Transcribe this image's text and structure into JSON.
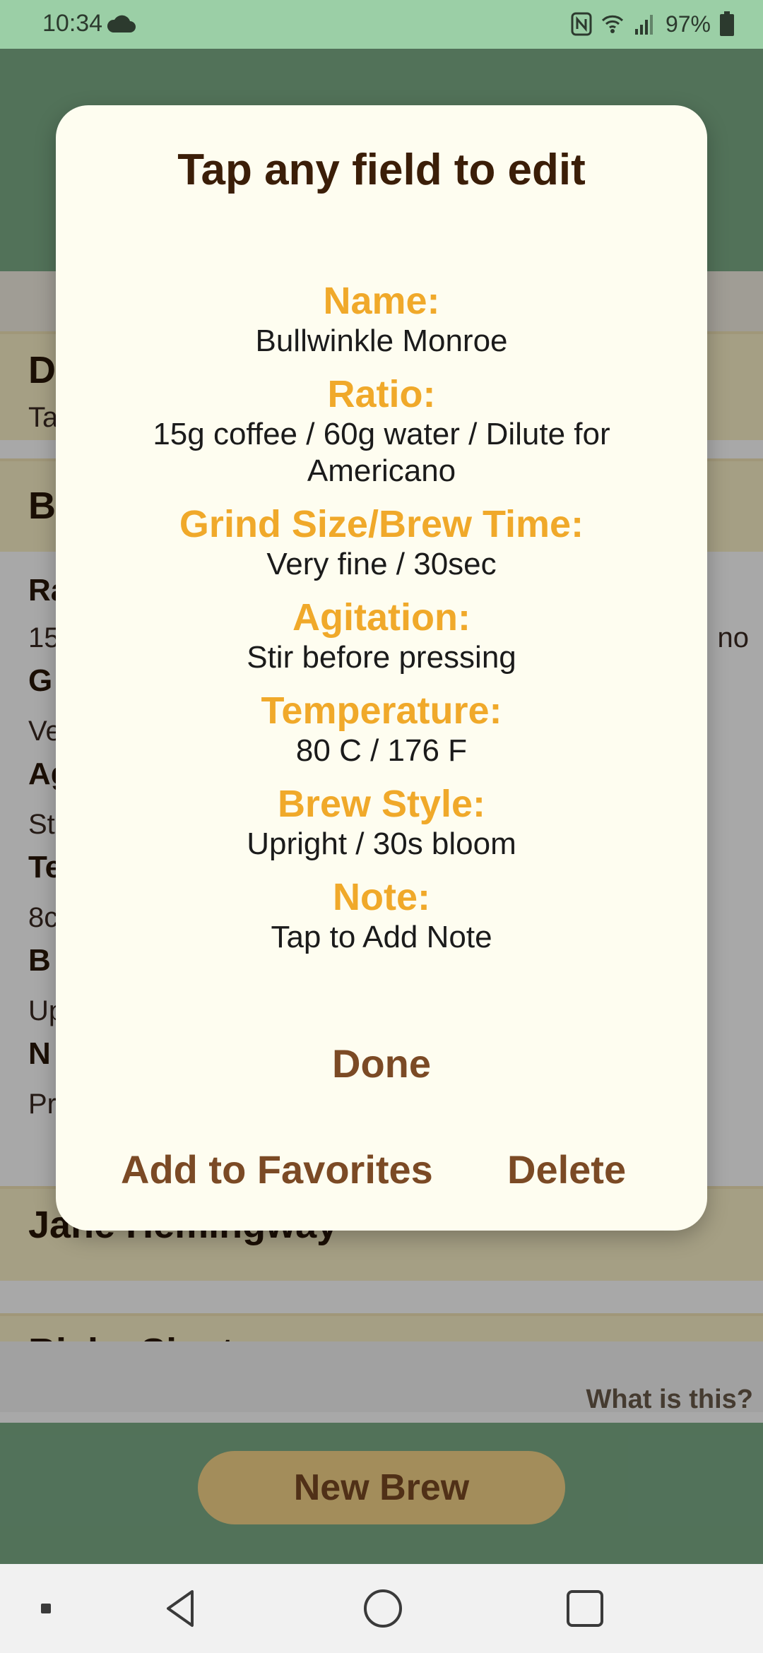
{
  "status_bar": {
    "time": "10:34",
    "battery": "97%"
  },
  "background": {
    "cards": [
      {
        "title": "D",
        "subtitle": "Ta"
      },
      {
        "title": "B"
      },
      {
        "title": "Jane Hemingway"
      },
      {
        "title": "Ricky Sinatra"
      }
    ],
    "details": {
      "rows": [
        {
          "label": "Ra",
          "value": "15",
          "value_right": "no"
        },
        {
          "label": "G",
          "value": "Ve"
        },
        {
          "label": "Ag",
          "value": "St"
        },
        {
          "label": "Te",
          "value": "8c"
        },
        {
          "label": "B",
          "value": "Up"
        },
        {
          "label": "N",
          "value": "Pr"
        }
      ]
    },
    "what_is_this": "What is this?",
    "new_brew": "New Brew"
  },
  "dialog": {
    "title": "Tap any field to edit",
    "fields": [
      {
        "label": "Name:",
        "value": "Bullwinkle Monroe"
      },
      {
        "label": "Ratio:",
        "value": "15g coffee / 60g water / Dilute for Americano"
      },
      {
        "label": "Grind Size/Brew Time:",
        "value": "Very fine / 30sec"
      },
      {
        "label": "Agitation:",
        "value": "Stir before pressing"
      },
      {
        "label": "Temperature:",
        "value": "80 C / 176 F"
      },
      {
        "label": "Brew Style:",
        "value": "Upright / 30s bloom"
      },
      {
        "label": "Note:",
        "value": "Tap to Add Note"
      }
    ],
    "done": "Done",
    "add_favorites": "Add to Favorites",
    "delete": "Delete"
  },
  "colors": {
    "field_label": "#f0a92a",
    "button": "#7b4a25",
    "title": "#3b1e08",
    "status_bar": "#9bcfa6",
    "header": "#7dad88"
  }
}
